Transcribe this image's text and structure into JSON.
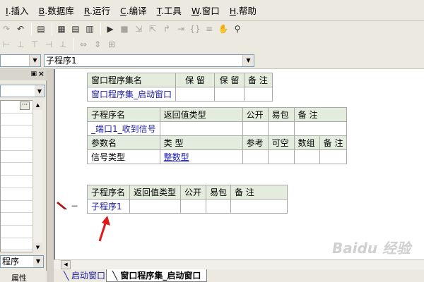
{
  "menu": [
    {
      "key": "I",
      "label": ".插入"
    },
    {
      "key": "B",
      "label": ".数据库"
    },
    {
      "key": "R",
      "label": ".运行"
    },
    {
      "key": "C",
      "label": ".编译"
    },
    {
      "key": "T",
      "label": ".工具"
    },
    {
      "key": "W",
      "label": ".窗口"
    },
    {
      "key": "H",
      "label": ".帮助"
    }
  ],
  "combo": {
    "subroutine_select": "子程序1"
  },
  "left_panel": {
    "bottom_select": "程序",
    "tabs": [
      "属性"
    ]
  },
  "table1": {
    "headers": [
      "窗口程序集名",
      "保 留",
      "保 留",
      "备 注"
    ],
    "row": [
      "窗口程序集_启动窗口",
      "",
      "",
      ""
    ]
  },
  "table2": {
    "headers": [
      "子程序名",
      "返回值类型",
      "公开",
      "易包",
      "备 注"
    ],
    "row": [
      "_端口1_收到信号",
      "",
      "",
      "",
      ""
    ],
    "param_headers": [
      "参数名",
      "类 型",
      "参考",
      "可空",
      "数组",
      "备 注"
    ],
    "param_row": [
      "信号类型",
      "整数型",
      "",
      "",
      "",
      ""
    ]
  },
  "table3": {
    "headers": [
      "子程序名",
      "返回值类型",
      "公开",
      "易包",
      "备 注"
    ],
    "row": [
      "子程序1",
      "",
      "",
      "",
      ""
    ]
  },
  "line_marker": "－",
  "tabs": [
    "启动窗口",
    "窗口程序集_启动窗口"
  ],
  "watermark": "Baidu 经验",
  "colors": {
    "header_bg": "#e4ecde",
    "link": "#1a1acc",
    "arrow": "#e01818"
  }
}
